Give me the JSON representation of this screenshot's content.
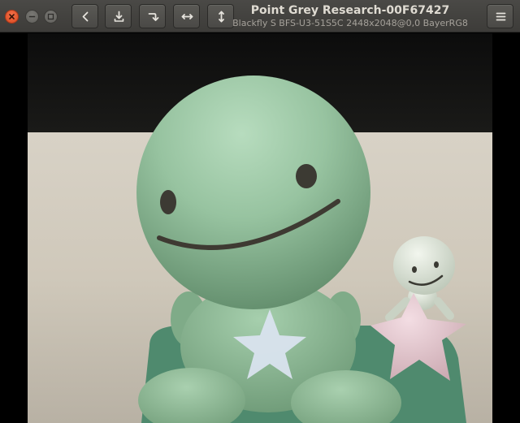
{
  "window": {
    "title": "Point Grey Research-00F67427",
    "subtitle": "Blackfly S BFS-U3-51S5C 2448x2048@0,0 BayerRG8"
  },
  "window_controls": {
    "close_icon": "close-icon",
    "minimize_icon": "minimize-icon",
    "maximize_icon": "maximize-icon"
  },
  "toolbar": {
    "icons": [
      "chevron-left-icon",
      "download-icon",
      "rotate-icon",
      "flip-horizontal-icon",
      "flip-vertical-icon",
      "hamburger-menu-icon"
    ]
  },
  "colors": {
    "header_bg": "#3d3c39",
    "close_button": "#e2552b",
    "title_text": "#dfdbd2",
    "subtitle_text": "#a5a19a",
    "figure_green": "#8fba97"
  }
}
